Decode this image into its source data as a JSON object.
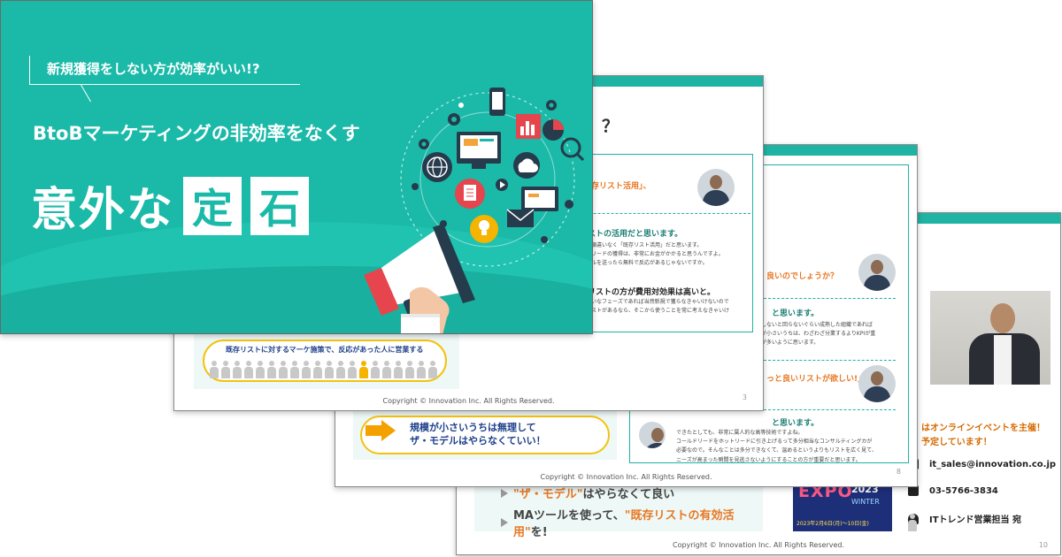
{
  "cover": {
    "subtitle": "新規獲得をしない方が効率がいい!?",
    "title": "BtoBマーケティングの非効率をなくす",
    "big_title_plain": "意外な",
    "big_title_box1": "定",
    "big_title_box2": "石"
  },
  "slide2": {
    "header": "！？",
    "quote": "存リスト活用」、",
    "answer": "ストの活用だと思います。",
    "body_lines": [
      "順違いなく「既存リスト活用」だと思います。",
      "リードの獲得は、非常にお金がかかると思うんですよ。",
      "ルを送ったら無料で反応があるじゃないですか。"
    ],
    "answer2": "リストの方が費用対効果は高いと。",
    "body_lines2": [
      "いなフェーズであれば当然新規で獲らなきゃいけないので",
      "ストがあるなら、そこから使うことを常に考えなきゃいけ"
    ],
    "pill_text": "既存リストに対するマーケ施策で、反応があった人に営業する",
    "copyright": "Copyright © Innovation Inc. All Rights Reserved.",
    "page": "3"
  },
  "slide3": {
    "question": "良いのでしょうか？",
    "answer": "と思います。",
    "body_lines": [
      "しないと回らないぐらい成熟した組織であれば",
      "が小さいうちは、わざわざ分業するよりKPIが重",
      "が多いように思います。"
    ],
    "question2": "っと良いリストが欲しい!」",
    "answer2": "と思います。",
    "body_lines2": [
      "できたとしても、非常に属人的な高等技術ですよね。",
      "コールドリードをホットリードに引き上げるって多分相当なコンサルティングカが",
      "必要なので。そんなことは多分できなくて、温めるというよりもリストを広く見て、",
      "ニーズが高まった瞬間を見逃さないようにすることの方が重要だと思います。"
    ],
    "pill_line1": "規模が小さいうちは無理して",
    "pill_line2": "ザ・モデルはやらなくていい！",
    "copyright": "Copyright © Innovation Inc. All Rights Reserved.",
    "page": "8"
  },
  "slide4": {
    "point1_q": "\"ザ・モデル\"",
    "point1_rest": "はやらなくて良い",
    "point2_pre": "MAツールを使って、",
    "point2_hl": "\"既存リストの有効活用\"",
    "point2_post": "を!",
    "event_line1": "はオンラインイベントを主催！",
    "event_line2": "予定しています！",
    "email": "it_sales@innovation.co.jp",
    "phone": "03-5766-3834",
    "recipient": "ITトレンド営業担当 宛",
    "expo_title_ex": "EXPO",
    "expo_year": "2023",
    "expo_winter": "WINTER",
    "expo_date": "2023年2月6日(月)〜10日(金)",
    "copyright": "Copyright © Innovation Inc. All Rights Reserved.",
    "page": "10"
  }
}
